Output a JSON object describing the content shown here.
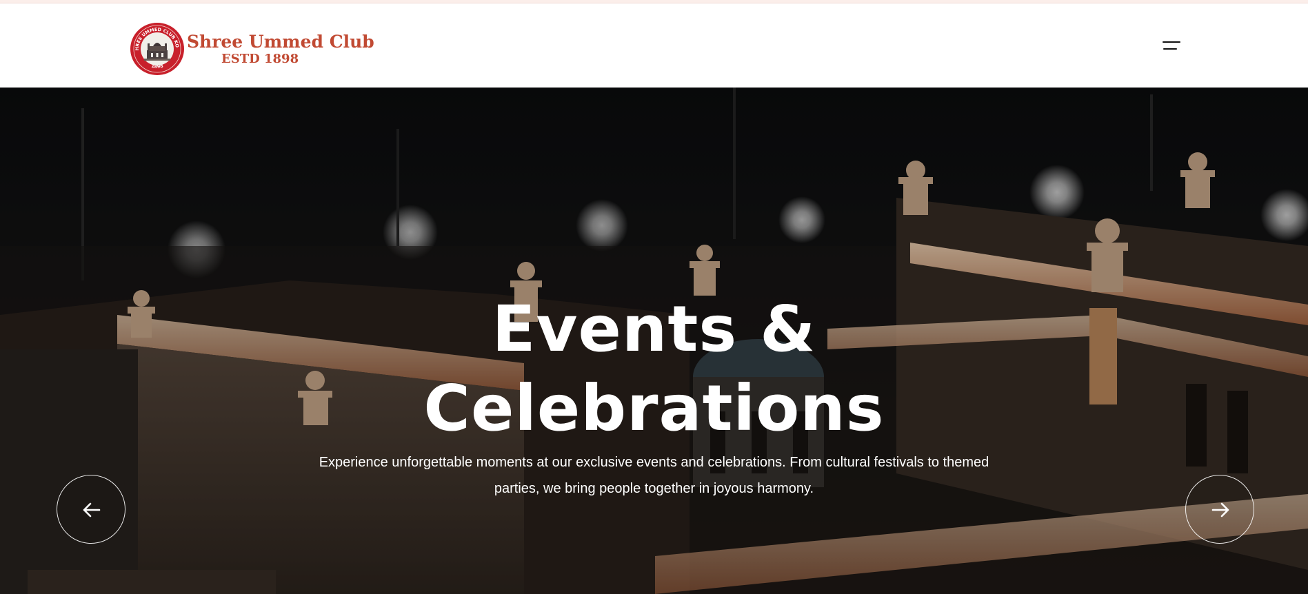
{
  "header": {
    "logo": {
      "title": "Shree Ummed Club",
      "subtitle": "ESTD 1898",
      "seal_text_top": "SHREE UMMED CLUB KOTA",
      "seal_text_bottom": "1898"
    },
    "menu_icon": "hamburger-menu-icon"
  },
  "hero": {
    "title_line1": "Events &",
    "title_line2": "Celebrations",
    "description": "Experience unforgettable moments at our exclusive events and celebrations. From cultural festivals to themed parties, we bring people together in joyous harmony.",
    "prev_icon": "arrow-left-icon",
    "next_icon": "arrow-right-icon"
  },
  "colors": {
    "brand_red": "#c8202b",
    "logo_text": "#c14a33",
    "hero_text": "#ffffff"
  }
}
